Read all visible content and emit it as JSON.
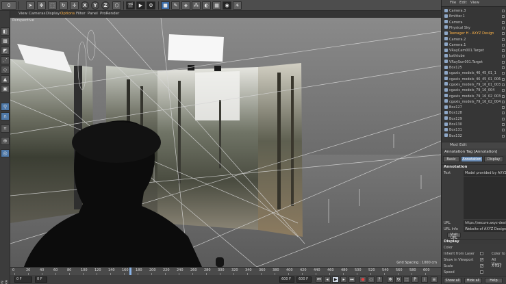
{
  "toolbar": {
    "undo_icon": "undo-arrow-icon",
    "axis_x": "X",
    "axis_y": "Y",
    "axis_z": "Z",
    "window_title_fragment": "0"
  },
  "viewport": {
    "menu": [
      "View",
      "Cameras",
      "Display",
      "Options",
      "Filter",
      "Panel",
      "ProRender"
    ],
    "active_menu_index": 3,
    "name": "Perspective",
    "grid_spacing": "Grid Spacing : 1000 cm"
  },
  "timeline": {
    "ticks": [
      "0",
      "20",
      "40",
      "60",
      "80",
      "100",
      "120",
      "140",
      "160",
      "180",
      "200",
      "220",
      "240",
      "260",
      "280",
      "300",
      "320",
      "340",
      "360",
      "380",
      "400",
      "420",
      "440",
      "460",
      "480",
      "500",
      "520",
      "540",
      "560",
      "580",
      "600"
    ],
    "end_label": "0 F",
    "playhead_fraction": 0.28
  },
  "transport": {
    "current_frame": "0 F",
    "min_frame": "0 F",
    "max_frame": "600 F",
    "end_frame": "600 F",
    "brand_vertical": "MAXON CINEMA 4D"
  },
  "object_manager": {
    "menu": [
      "File",
      "Edit",
      "View"
    ],
    "items": [
      {
        "label": "Camera.3",
        "selected": false
      },
      {
        "label": "Emitter.1",
        "selected": false
      },
      {
        "label": "Camera",
        "selected": false
      },
      {
        "label": "Physical Sky",
        "selected": false
      },
      {
        "label": "Teenager H - AXYZ Design",
        "selected": true
      },
      {
        "label": "Camera.2",
        "selected": false
      },
      {
        "label": "Camera.1",
        "selected": false
      },
      {
        "label": "VRayCam001.Target",
        "selected": false
      },
      {
        "label": "bathtube",
        "selected": false
      },
      {
        "label": "VRaySun001.Target",
        "selected": false
      },
      {
        "label": "Box125",
        "selected": false
      },
      {
        "label": "cgaxis_models_46_45_01_1",
        "selected": false
      },
      {
        "label": "cgaxis_models_46_45_01_006",
        "selected": false
      },
      {
        "label": "cgaxis_models_79_16_01_003",
        "selected": false
      },
      {
        "label": "cgaxis_models_79_16_004",
        "selected": false
      },
      {
        "label": "cgaxis_models_79_16_02_003",
        "selected": false
      },
      {
        "label": "cgaxis_models_79_16_02_004",
        "selected": false
      },
      {
        "label": "Box127",
        "selected": false
      },
      {
        "label": "Box128",
        "selected": false
      },
      {
        "label": "Box129",
        "selected": false
      },
      {
        "label": "Box130",
        "selected": false
      },
      {
        "label": "Box131",
        "selected": false
      },
      {
        "label": "Box132",
        "selected": false
      }
    ]
  },
  "attribute_manager": {
    "menu": [
      "Mod",
      "Edit"
    ],
    "title": "Annotation Tag [Annotation]",
    "tabs": [
      "Basic",
      "Annotation",
      "Display"
    ],
    "active_tab_index": 1,
    "section_annotation": "Annotation",
    "text_label": "Text",
    "text_value": "Model provided by AXYZ D",
    "url_label": "URL",
    "url_value": "https://secure.axyz-design.com",
    "url_info_label": "URL Info",
    "url_info_value": "Website of AXYZ Design",
    "visit_button": "Visit URL",
    "section_display": "Display",
    "color_label": "Color",
    "inherit_label": "Inherit from Layer",
    "color_tool_label": "Color to",
    "show_viewport_label": "Show in Viewport",
    "all_views_label": "All Views",
    "scale_label": "Scale",
    "xray_label": "X-Ray",
    "speed_label": "Speed",
    "show_all_button": "Show all",
    "hide_all_button": "Hide all",
    "help_button": "Help"
  },
  "colors": {
    "accent_orange": "#ffb347",
    "accent_blue": "#6d8fb8"
  }
}
